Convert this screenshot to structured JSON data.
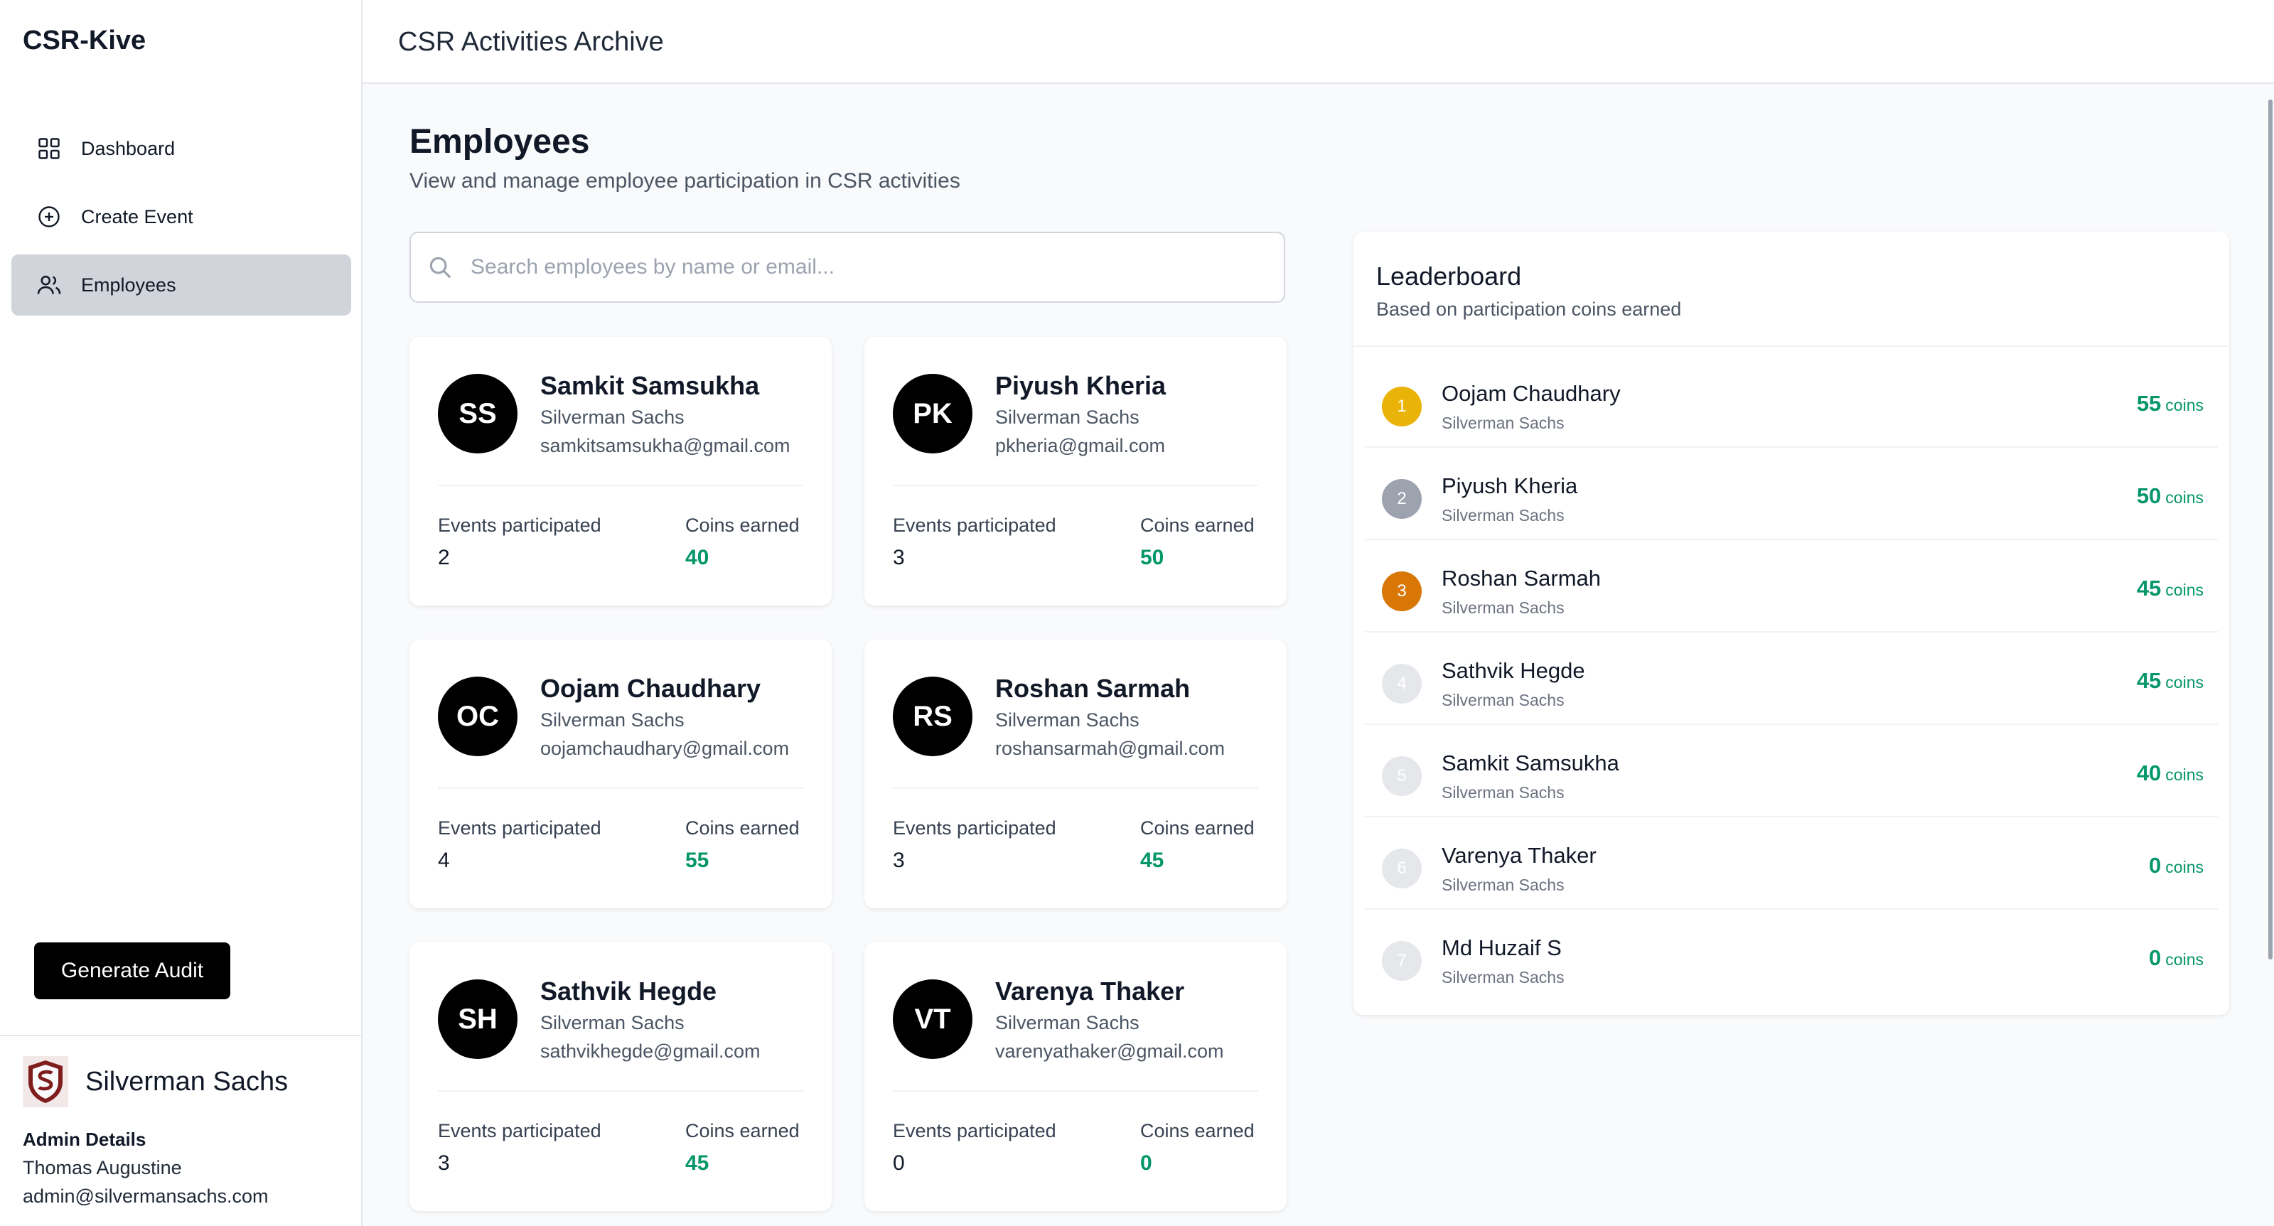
{
  "app": {
    "brand": "CSR-Kive",
    "header_title": "CSR Activities Archive"
  },
  "sidebar": {
    "items": [
      {
        "label": "Dashboard",
        "icon": "grid-icon",
        "active": false
      },
      {
        "label": "Create Event",
        "icon": "plus-circle-icon",
        "active": false
      },
      {
        "label": "Employees",
        "icon": "users-icon",
        "active": true
      }
    ],
    "audit_button": "Generate Audit",
    "org_name": "Silverman Sachs",
    "admin_title": "Admin Details",
    "admin_name": "Thomas Augustine",
    "admin_email": "admin@silvermansachs.com"
  },
  "page": {
    "title": "Employees",
    "subtitle": "View and manage employee participation in CSR activities"
  },
  "search": {
    "placeholder": "Search employees by name or email..."
  },
  "employees": [
    {
      "initials": "SS",
      "name": "Samkit Samsukha",
      "company": "Silverman Sachs",
      "email": "samkitsamsukha@gmail.com",
      "events_label": "Events participated",
      "events": "2",
      "coins_label": "Coins earned",
      "coins": "40"
    },
    {
      "initials": "PK",
      "name": "Piyush Kheria",
      "company": "Silverman Sachs",
      "email": "pkheria@gmail.com",
      "events_label": "Events participated",
      "events": "3",
      "coins_label": "Coins earned",
      "coins": "50"
    },
    {
      "initials": "OC",
      "name": "Oojam Chaudhary",
      "company": "Silverman Sachs",
      "email": "oojamchaudhary@gmail.com",
      "events_label": "Events participated",
      "events": "4",
      "coins_label": "Coins earned",
      "coins": "55"
    },
    {
      "initials": "RS",
      "name": "Roshan Sarmah",
      "company": "Silverman Sachs",
      "email": "roshansarmah@gmail.com",
      "events_label": "Events participated",
      "events": "3",
      "coins_label": "Coins earned",
      "coins": "45"
    },
    {
      "initials": "SH",
      "name": "Sathvik Hegde",
      "company": "Silverman Sachs",
      "email": "sathvikhegde@gmail.com",
      "events_label": "Events participated",
      "events": "3",
      "coins_label": "Coins earned",
      "coins": "45"
    },
    {
      "initials": "VT",
      "name": "Varenya Thaker",
      "company": "Silverman Sachs",
      "email": "varenyathaker@gmail.com",
      "events_label": "Events participated",
      "events": "0",
      "coins_label": "Coins earned",
      "coins": "0"
    }
  ],
  "leaderboard": {
    "title": "Leaderboard",
    "subtitle": "Based on participation coins earned",
    "coin_unit": "coins",
    "rows": [
      {
        "rank": "1",
        "name": "Oojam Chaudhary",
        "company": "Silverman Sachs",
        "coins": "55",
        "badge_color": "#eab308"
      },
      {
        "rank": "2",
        "name": "Piyush Kheria",
        "company": "Silverman Sachs",
        "coins": "50",
        "badge_color": "#9ca3af"
      },
      {
        "rank": "3",
        "name": "Roshan Sarmah",
        "company": "Silverman Sachs",
        "coins": "45",
        "badge_color": "#d97706"
      },
      {
        "rank": "4",
        "name": "Sathvik Hegde",
        "company": "Silverman Sachs",
        "coins": "45",
        "badge_color": "#e5e7eb"
      },
      {
        "rank": "5",
        "name": "Samkit Samsukha",
        "company": "Silverman Sachs",
        "coins": "40",
        "badge_color": "#e5e7eb"
      },
      {
        "rank": "6",
        "name": "Varenya Thaker",
        "company": "Silverman Sachs",
        "coins": "0",
        "badge_color": "#e5e7eb"
      },
      {
        "rank": "7",
        "name": "Md Huzaif S",
        "company": "Silverman Sachs",
        "coins": "0",
        "badge_color": "#e5e7eb"
      }
    ]
  },
  "colors": {
    "accent_green": "#059669",
    "active_nav": "#d1d5db"
  }
}
